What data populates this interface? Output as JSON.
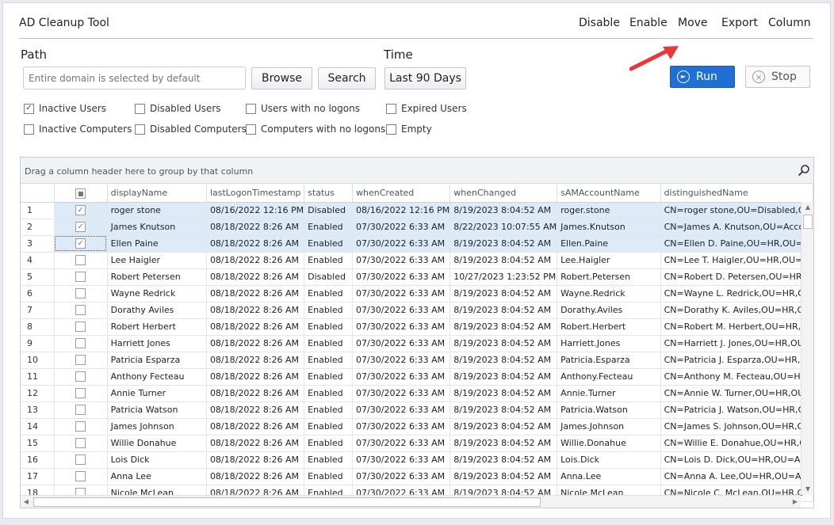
{
  "app": {
    "title": "AD Cleanup Tool"
  },
  "menu": [
    "Disable",
    "Enable",
    "Move",
    "Export",
    "Column"
  ],
  "path": {
    "label": "Path",
    "placeholder": "Entire domain is selected by default",
    "browse_label": "Browse",
    "search_label": "Search"
  },
  "time": {
    "label": "Time",
    "value": "Last 90 Days"
  },
  "actions": {
    "run_label": "Run",
    "stop_label": "Stop"
  },
  "filters": [
    {
      "label": "Inactive Users",
      "checked": true
    },
    {
      "label": "Disabled Users",
      "checked": false
    },
    {
      "label": "Users with no logons",
      "checked": false
    },
    {
      "label": "Expired Users",
      "checked": false
    },
    {
      "label": "Inactive Computers",
      "checked": false
    },
    {
      "label": "Disabled Computers",
      "checked": false
    },
    {
      "label": "Computers with no logons",
      "checked": false
    },
    {
      "label": "Empty",
      "checked": false
    }
  ],
  "grid": {
    "group_hint": "Drag a column header here to group by that column",
    "columns": [
      "displayName",
      "lastLogonTimestamp",
      "status",
      "whenCreated",
      "whenChanged",
      "sAMAccountName",
      "distinguishedName"
    ],
    "rows": [
      {
        "num": "1",
        "checked": true,
        "cells": [
          "roger stone",
          "08/16/2022 12:16 PM",
          "Disabled",
          "08/16/2022 12:16 PM",
          "8/19/2023 8:04:52 AM",
          "roger.stone",
          "CN=roger stone,OU=Disabled,OU"
        ]
      },
      {
        "num": "2",
        "checked": true,
        "cells": [
          "James Knutson",
          "08/18/2022 8:26 AM",
          "Enabled",
          "07/30/2022 6:33 AM",
          "8/22/2023 10:07:55 AM",
          "James.Knutson",
          "CN=James A. Knutson,OU=Accou"
        ]
      },
      {
        "num": "3",
        "checked": true,
        "cells": [
          "Ellen Paine",
          "08/18/2022 8:26 AM",
          "Enabled",
          "07/30/2022 6:33 AM",
          "8/19/2023 8:04:52 AM",
          "Ellen.Paine",
          "CN=Ellen D. Paine,OU=HR,OU=A"
        ]
      },
      {
        "num": "4",
        "checked": false,
        "cells": [
          "Lee Haigler",
          "08/18/2022 8:26 AM",
          "Enabled",
          "07/30/2022 6:33 AM",
          "8/19/2023 8:04:52 AM",
          "Lee.Haigler",
          "CN=Lee T. Haigler,OU=HR,OU=A"
        ]
      },
      {
        "num": "5",
        "checked": false,
        "cells": [
          "Robert Petersen",
          "08/18/2022 8:26 AM",
          "Disabled",
          "07/30/2022 6:33 AM",
          "10/27/2023 1:23:52 PM",
          "Robert.Petersen",
          "CN=Robert D. Petersen,OU=HR,("
        ]
      },
      {
        "num": "6",
        "checked": false,
        "cells": [
          "Wayne Redrick",
          "08/18/2022 8:26 AM",
          "Enabled",
          "07/30/2022 6:33 AM",
          "8/19/2023 8:04:52 AM",
          "Wayne.Redrick",
          "CN=Wayne L. Redrick,OU=HR,OU"
        ]
      },
      {
        "num": "7",
        "checked": false,
        "cells": [
          "Dorathy Aviles",
          "08/18/2022 8:26 AM",
          "Enabled",
          "07/30/2022 6:33 AM",
          "8/19/2023 8:04:52 AM",
          "Dorathy.Aviles",
          "CN=Dorathy K. Aviles,OU=HR,OU"
        ]
      },
      {
        "num": "8",
        "checked": false,
        "cells": [
          "Robert Herbert",
          "08/18/2022 8:26 AM",
          "Enabled",
          "07/30/2022 6:33 AM",
          "8/19/2023 8:04:52 AM",
          "Robert.Herbert",
          "CN=Robert M. Herbert,OU=HR,C"
        ]
      },
      {
        "num": "9",
        "checked": false,
        "cells": [
          "Harriett Jones",
          "08/18/2022 8:26 AM",
          "Enabled",
          "07/30/2022 6:33 AM",
          "8/19/2023 8:04:52 AM",
          "Harriett.Jones",
          "CN=Harriett J. Jones,OU=HR,OU"
        ]
      },
      {
        "num": "10",
        "checked": false,
        "cells": [
          "Patricia Esparza",
          "08/18/2022 8:26 AM",
          "Enabled",
          "07/30/2022 6:33 AM",
          "8/19/2023 8:04:52 AM",
          "Patricia.Esparza",
          "CN=Patricia J. Esparza,OU=HR,O"
        ]
      },
      {
        "num": "11",
        "checked": false,
        "cells": [
          "Anthony Fecteau",
          "08/18/2022 8:26 AM",
          "Enabled",
          "07/30/2022 6:33 AM",
          "8/19/2023 8:04:52 AM",
          "Anthony.Fecteau",
          "CN=Anthony M. Fecteau,OU=HR"
        ]
      },
      {
        "num": "12",
        "checked": false,
        "cells": [
          "Annie Turner",
          "08/18/2022 8:26 AM",
          "Enabled",
          "07/30/2022 6:33 AM",
          "8/19/2023 8:04:52 AM",
          "Annie.Turner",
          "CN=Annie W. Turner,OU=HR,OU="
        ]
      },
      {
        "num": "13",
        "checked": false,
        "cells": [
          "Patricia Watson",
          "08/18/2022 8:26 AM",
          "Enabled",
          "07/30/2022 6:33 AM",
          "8/19/2023 8:04:52 AM",
          "Patricia.Watson",
          "CN=Patricia J. Watson,OU=HR,OU"
        ]
      },
      {
        "num": "14",
        "checked": false,
        "cells": [
          "James Johnson",
          "08/18/2022 8:26 AM",
          "Enabled",
          "07/30/2022 6:33 AM",
          "8/19/2023 8:04:52 AM",
          "James.Johnson",
          "CN=James S. Johnson,OU=HR,OU"
        ]
      },
      {
        "num": "15",
        "checked": false,
        "cells": [
          "Willie Donahue",
          "08/18/2022 8:26 AM",
          "Enabled",
          "07/30/2022 6:33 AM",
          "8/19/2023 8:04:52 AM",
          "Willie.Donahue",
          "CN=Willie E. Donahue,OU=HR,OU"
        ]
      },
      {
        "num": "16",
        "checked": false,
        "cells": [
          "Lois Dick",
          "08/18/2022 8:26 AM",
          "Enabled",
          "07/30/2022 6:33 AM",
          "8/19/2023 8:04:52 AM",
          "Lois.Dick",
          "CN=Lois D. Dick,OU=HR,OU=ADF"
        ]
      },
      {
        "num": "17",
        "checked": false,
        "cells": [
          "Anna Lee",
          "08/18/2022 8:26 AM",
          "Enabled",
          "07/30/2022 6:33 AM",
          "8/19/2023 8:04:52 AM",
          "Anna.Lee",
          "CN=Anna A. Lee,OU=HR,OU=AD"
        ]
      },
      {
        "num": "18",
        "checked": false,
        "cells": [
          "Nicole McLean",
          "08/18/2022 8:26 AM",
          "Enabled",
          "07/30/2022 6:33 AM",
          "8/19/2023 8:04:52 AM",
          "Nicole.McLean",
          "CN=Nicole C. McLean,OU=HR,O"
        ]
      }
    ]
  },
  "colors": {
    "accent": "#1f6fd6",
    "selected_row": "#dcebf7",
    "annotation_arrow": "#e8383d"
  }
}
